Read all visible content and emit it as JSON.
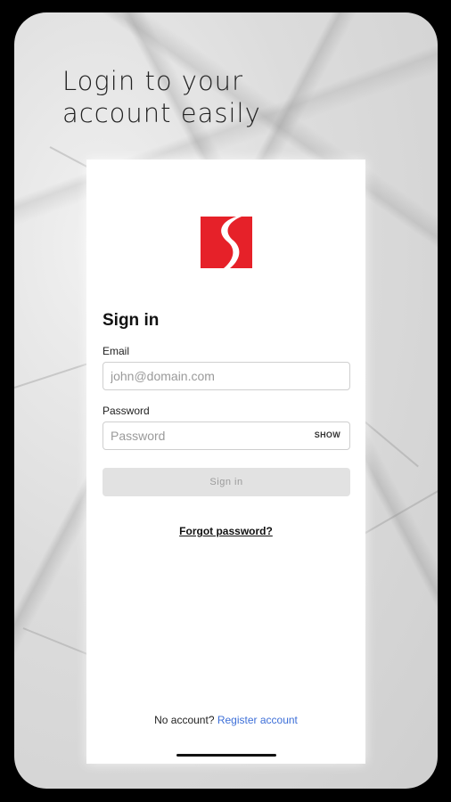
{
  "headline": {
    "line1": "Login to your",
    "line2": "account easily"
  },
  "brand": {
    "logo_icon": "brand-s-logo-icon",
    "logo_color": "#e62129"
  },
  "signin": {
    "title": "Sign in",
    "email_label": "Email",
    "email_placeholder": "john@domain.com",
    "email_value": "",
    "password_label": "Password",
    "password_placeholder": "Password",
    "password_value": "",
    "show_label": "SHOW",
    "submit_label": "Sign in",
    "forgot_label": "Forgot password?"
  },
  "footer": {
    "prompt": "No account?",
    "register_label": "Register account",
    "link_color": "#3d6fd8"
  }
}
